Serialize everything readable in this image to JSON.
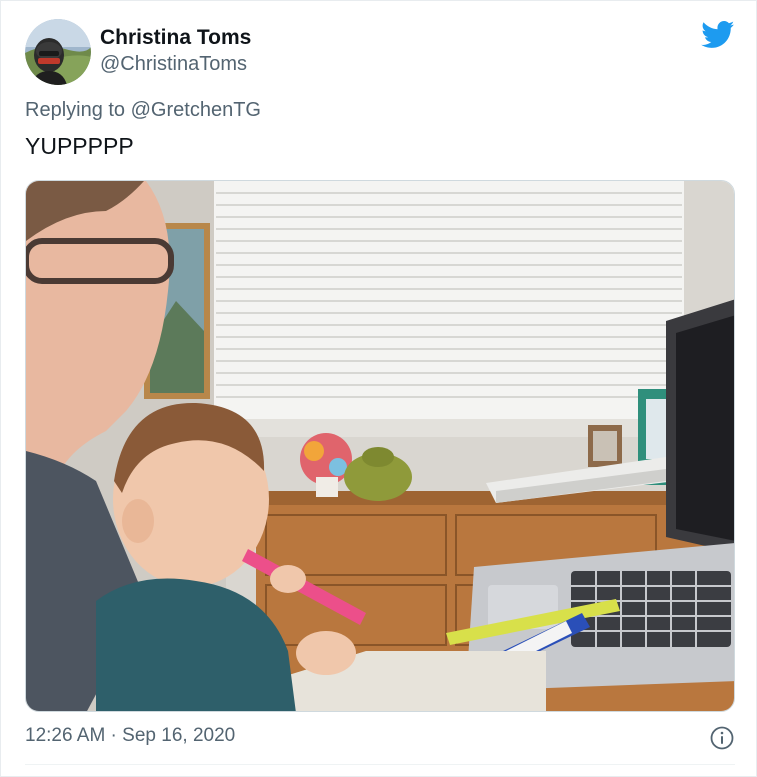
{
  "author": {
    "display_name": "Christina Toms",
    "handle": "@ChristinaToms"
  },
  "reply": {
    "prefix": "Replying to ",
    "handle": "@GretchenTG"
  },
  "tweet": {
    "text": "YUPPPPP"
  },
  "meta": {
    "timestamp": "12:26 AM · Sep 16, 2020"
  },
  "colors": {
    "brand": "#1d9bf0",
    "secondary_text": "#536471",
    "primary_text": "#0f1419"
  },
  "icons": {
    "brand": "twitter-bird-icon",
    "info": "info-icon"
  }
}
